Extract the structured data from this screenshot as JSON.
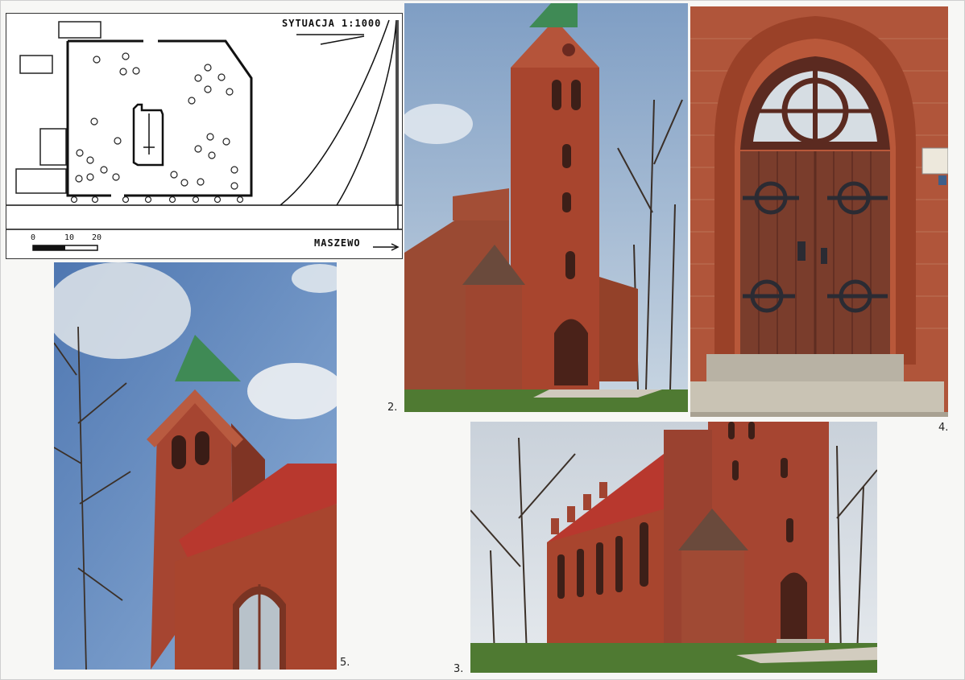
{
  "site_plan": {
    "title": "SYTUACJA 1:1000",
    "place": "MASZEWO",
    "scale_ticks": [
      "0",
      "10",
      "20"
    ]
  },
  "photos": [
    {
      "number": "2.",
      "subject": "church tower and nave from the side"
    },
    {
      "number": "3.",
      "subject": "church nave with red roof and tower"
    },
    {
      "number": "4.",
      "subject": "arched wooden entrance door"
    },
    {
      "number": "5.",
      "subject": "tower spire and nave roof from below"
    }
  ],
  "colors": {
    "brick": "#a8452e",
    "roof": "#b8382e",
    "spire": "#3f8a55",
    "sky": "#8fa9c6",
    "grass": "#4f7a32",
    "door": "#7a3d2c"
  }
}
